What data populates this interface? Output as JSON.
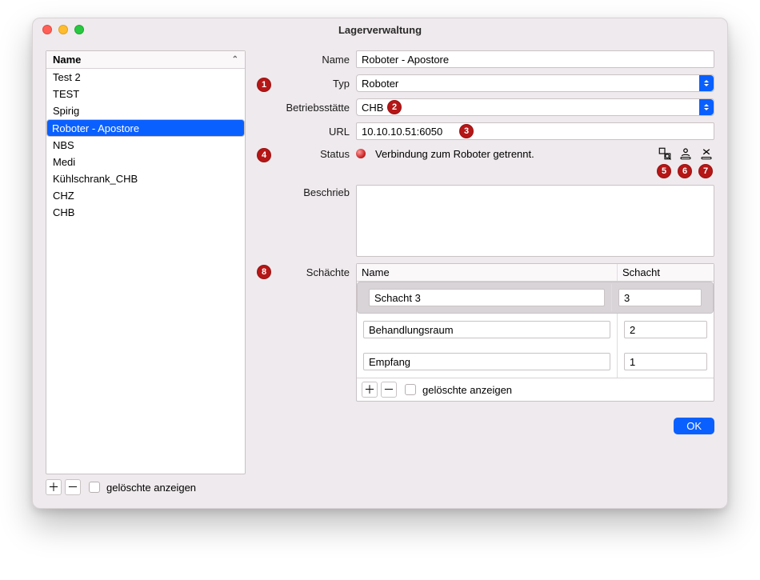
{
  "window": {
    "title": "Lagerverwaltung"
  },
  "list": {
    "header": "Name",
    "items": [
      {
        "name": "Test 2",
        "selected": false
      },
      {
        "name": "TEST",
        "selected": false
      },
      {
        "name": "Spirig",
        "selected": false
      },
      {
        "name": "Roboter - Apostore",
        "selected": true
      },
      {
        "name": "NBS",
        "selected": false
      },
      {
        "name": "Medi",
        "selected": false
      },
      {
        "name": "Kühlschrank_CHB",
        "selected": false
      },
      {
        "name": "CHZ",
        "selected": false
      },
      {
        "name": "CHB",
        "selected": false
      }
    ],
    "show_deleted_label": "gelöschte anzeigen"
  },
  "form": {
    "name_label": "Name",
    "name_value": "Roboter - Apostore",
    "type_label": "Typ",
    "type_value": "Roboter",
    "site_label": "Betriebsstätte",
    "site_value": "CHB",
    "url_label": "URL",
    "url_value": "10.10.10.51:6050",
    "status_label": "Status",
    "status_text": "Verbindung zum Roboter getrennt.",
    "status_color": "#c21818",
    "desc_label": "Beschrieb",
    "desc_value": ""
  },
  "icons": {
    "stock_query": "stock-query-icon",
    "upload_stock": "upload-stock-icon",
    "clear_stock": "clear-stock-icon"
  },
  "slots": {
    "label": "Schächte",
    "col_name": "Name",
    "col_slot": "Schacht",
    "rows": [
      {
        "name": "Schacht 3",
        "slot": "3",
        "selected": true
      },
      {
        "name": "Behandlungsraum",
        "slot": "2",
        "selected": false
      },
      {
        "name": "Empfang",
        "slot": "1",
        "selected": false
      }
    ],
    "show_deleted_label": "gelöschte anzeigen"
  },
  "buttons": {
    "ok": "OK"
  },
  "callouts": [
    "1",
    "2",
    "3",
    "4",
    "5",
    "6",
    "7",
    "8"
  ]
}
